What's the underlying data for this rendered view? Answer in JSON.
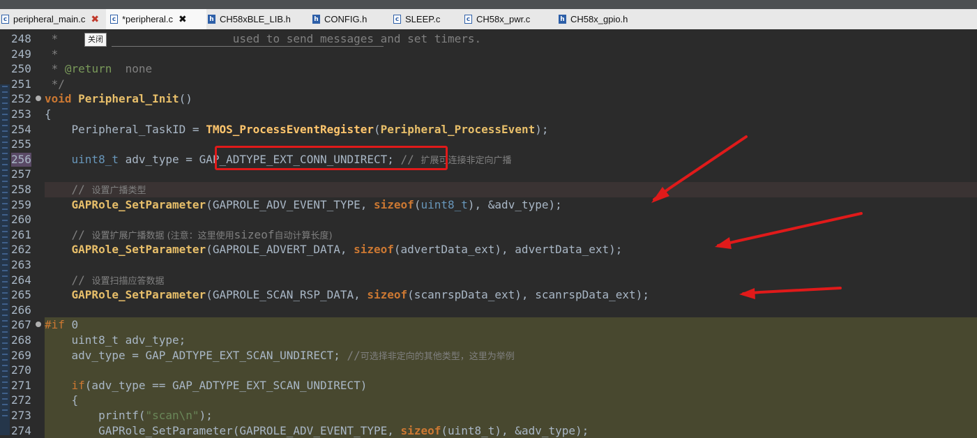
{
  "tabs": [
    {
      "label": "peripheral_main.c",
      "icon": "c-file-icon",
      "close": true,
      "active": false
    },
    {
      "label": "*peripheral.c",
      "icon": "c-file-icon",
      "close": true,
      "active": true
    },
    {
      "label": "CH58xBLE_LIB.h",
      "icon": "h-file-icon",
      "close": false,
      "active": false
    },
    {
      "label": "CONFIG.h",
      "icon": "h-file-icon",
      "close": false,
      "active": false
    },
    {
      "label": "SLEEP.c",
      "icon": "c-file-icon",
      "close": false,
      "active": false
    },
    {
      "label": "CH58x_pwr.c",
      "icon": "c-file-icon",
      "close": false,
      "active": false
    },
    {
      "label": "CH58x_gpio.h",
      "icon": "h-file-icon",
      "close": false,
      "active": false
    }
  ],
  "tooltip": "关闭",
  "colors": {
    "editor_bg": "#2b2b2b",
    "disabled_block_bg": "#48482f",
    "current_line_bg": "#3a3333",
    "annotation_red": "#e01a1a"
  },
  "lines": [
    {
      "n": "248",
      "parts": [
        [
          "c-com",
          " *    "
        ],
        [
          "c-com",
          "                      used to send messages and set timers."
        ]
      ]
    },
    {
      "n": "249",
      "parts": [
        [
          "c-com",
          " *"
        ]
      ]
    },
    {
      "n": "250",
      "parts": [
        [
          "c-com",
          " * "
        ],
        [
          "c-tag",
          "@return"
        ],
        [
          "c-com",
          "  none"
        ]
      ]
    },
    {
      "n": "251",
      "parts": [
        [
          "c-com",
          " */"
        ]
      ]
    },
    {
      "n": "252",
      "fold": true,
      "parts": [
        [
          "c-kw",
          "void"
        ],
        [
          "c-dim",
          " "
        ],
        [
          "c-fnb",
          "Peripheral_Init"
        ],
        [
          "c-dim",
          "()"
        ]
      ]
    },
    {
      "n": "253",
      "parts": [
        [
          "c-dim",
          "{"
        ]
      ]
    },
    {
      "n": "254",
      "parts": [
        [
          "c-dim",
          "    Peripheral_TaskID = "
        ],
        [
          "c-fn",
          "TMOS_ProcessEventRegister"
        ],
        [
          "c-dim",
          "("
        ],
        [
          "c-fnb",
          "Peripheral_ProcessEvent"
        ],
        [
          "c-dim",
          ");"
        ]
      ]
    },
    {
      "n": "255",
      "parts": []
    },
    {
      "n": "256",
      "hl_num": true,
      "parts": [
        [
          "c-ty",
          "    uint8_t"
        ],
        [
          "c-dim",
          " adv_type = "
        ],
        [
          "c-dim",
          "GAP_ADTYPE_EXT_CONN_UNDIRECT"
        ],
        [
          "c-dim",
          "; "
        ],
        [
          "c-com",
          "// "
        ],
        [
          "c-cn",
          "扩展可连接非定向广播"
        ]
      ]
    },
    {
      "n": "257",
      "parts": []
    },
    {
      "n": "258",
      "current": true,
      "parts": [
        [
          "c-com",
          "    // "
        ],
        [
          "c-cn",
          "设置广播类型"
        ]
      ]
    },
    {
      "n": "259",
      "parts": [
        [
          "c-fnb",
          "    GAPRole_SetParameter"
        ],
        [
          "c-dim",
          "(GAPROLE_ADV_EVENT_TYPE, "
        ],
        [
          "c-kw",
          "sizeof"
        ],
        [
          "c-dim",
          "("
        ],
        [
          "c-ty",
          "uint8_t"
        ],
        [
          "c-dim",
          "), &adv_type);"
        ]
      ]
    },
    {
      "n": "260",
      "parts": []
    },
    {
      "n": "261",
      "parts": [
        [
          "c-com",
          "    // "
        ],
        [
          "c-cn",
          "设置扩展广播数据 (注意：这里使用"
        ],
        [
          "c-com",
          "sizeof"
        ],
        [
          "c-cn",
          "自动计算长度)"
        ]
      ]
    },
    {
      "n": "262",
      "parts": [
        [
          "c-fnb",
          "    GAPRole_SetParameter"
        ],
        [
          "c-dim",
          "(GAPROLE_ADVERT_DATA, "
        ],
        [
          "c-kw",
          "sizeof"
        ],
        [
          "c-dim",
          "(advertData_ext), advertData_ext);"
        ]
      ]
    },
    {
      "n": "263",
      "parts": []
    },
    {
      "n": "264",
      "parts": [
        [
          "c-com",
          "    // "
        ],
        [
          "c-cn",
          "设置扫描应答数据"
        ]
      ]
    },
    {
      "n": "265",
      "parts": [
        [
          "c-fnb",
          "    GAPRole_SetParameter"
        ],
        [
          "c-dim",
          "(GAPROLE_SCAN_RSP_DATA, "
        ],
        [
          "c-kw",
          "sizeof"
        ],
        [
          "c-dim",
          "(scanrspData_ext), scanrspData_ext);"
        ]
      ]
    },
    {
      "n": "266",
      "parts": []
    },
    {
      "n": "267",
      "fold": true,
      "disabled": true,
      "parts": [
        [
          "c-kwn",
          "#if"
        ],
        [
          "c-dim",
          " 0"
        ]
      ]
    },
    {
      "n": "268",
      "disabled": true,
      "parts": [
        [
          "c-dim",
          "    uint8_t adv_type;"
        ]
      ]
    },
    {
      "n": "269",
      "disabled": true,
      "parts": [
        [
          "c-dim",
          "    adv_type = GAP_ADTYPE_EXT_SCAN_UNDIRECT; "
        ],
        [
          "c-com",
          "//"
        ],
        [
          "c-cn",
          "可选择非定向的其他类型，这里为举例"
        ]
      ]
    },
    {
      "n": "270",
      "disabled": true,
      "parts": []
    },
    {
      "n": "271",
      "disabled": true,
      "parts": [
        [
          "c-kwn",
          "    if"
        ],
        [
          "c-dim",
          "(adv_type == GAP_ADTYPE_EXT_SCAN_UNDIRECT)"
        ]
      ]
    },
    {
      "n": "272",
      "disabled": true,
      "parts": [
        [
          "c-dim",
          "    {"
        ]
      ]
    },
    {
      "n": "273",
      "disabled": true,
      "parts": [
        [
          "c-dim",
          "        printf("
        ],
        [
          "c-str",
          "\"scan\\n\""
        ],
        [
          "c-dim",
          ");"
        ]
      ]
    },
    {
      "n": "274",
      "disabled": true,
      "parts": [
        [
          "c-dim",
          "        GAPRole_SetParameter(GAPROLE_ADV_EVENT_TYPE, "
        ],
        [
          "c-kw",
          "sizeof"
        ],
        [
          "c-dim",
          "(uint8_t), &adv_type);"
        ]
      ]
    }
  ]
}
